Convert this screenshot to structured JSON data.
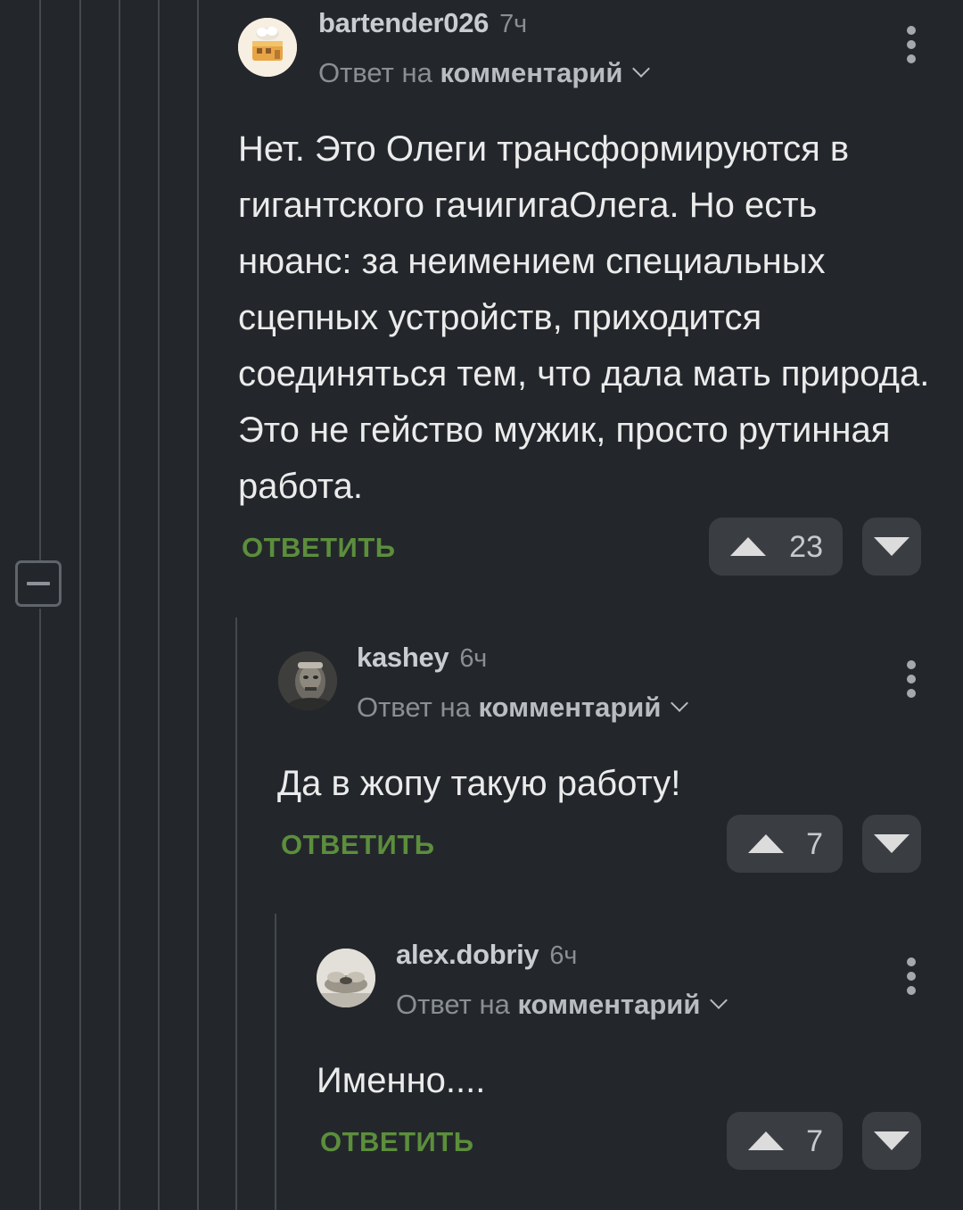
{
  "comments": [
    {
      "username": "bartender026",
      "time": "7ч",
      "reply_prefix": "Ответ на",
      "reply_target": "комментарий",
      "body": "Нет. Это Олеги трансформируются в гигантского гачигигаОлега. Но есть нюанс: за неимением специальных сцепных устройств, приходится соединяться тем, что дала мать природа. Это не гейство мужик, просто рутинная работа.",
      "reply_label": "ОТВЕТИТЬ",
      "rating": "23"
    },
    {
      "username": "kashey",
      "time": "6ч",
      "reply_prefix": "Ответ на",
      "reply_target": "комментарий",
      "body": "Да в жопу такую работу!",
      "reply_label": "ОТВЕТИТЬ",
      "rating": "7"
    },
    {
      "username": "alex.dobriy",
      "time": "6ч",
      "reply_prefix": "Ответ на",
      "reply_target": "комментарий",
      "body": "Именно....",
      "reply_label": "ОТВЕТИТЬ",
      "rating": "7"
    }
  ],
  "colors": {
    "background": "#23272b",
    "reply_accent": "#5c8e3c",
    "thread_line": "#44494e"
  },
  "icons": {
    "collapse": "minus-square-icon",
    "menu": "vertical-dots-icon",
    "upvote": "triangle-up-icon",
    "downvote": "triangle-down-icon",
    "chevron": "chevron-down-icon"
  }
}
